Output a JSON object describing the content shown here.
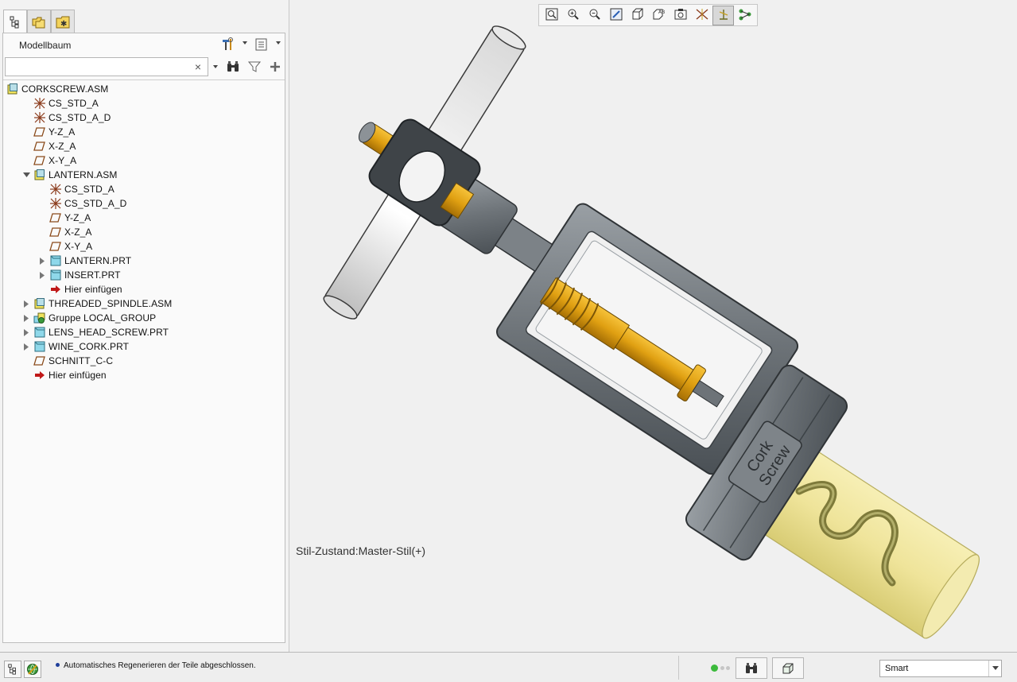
{
  "panel": {
    "tabs": [
      {
        "name": "model-tree-tab"
      },
      {
        "name": "folder-browser-tab"
      },
      {
        "name": "favorites-tab"
      }
    ],
    "title": "Modellbaum",
    "search": {
      "value": "",
      "placeholder": "",
      "clear_glyph": "×"
    }
  },
  "tree": [
    {
      "label": "CORKSCREW.ASM",
      "icon": "assembly-icon",
      "level": 0,
      "expander": "none"
    },
    {
      "label": "CS_STD_A",
      "icon": "csys-icon",
      "level": 1,
      "expander": "none"
    },
    {
      "label": "CS_STD_A_D",
      "icon": "csys-icon",
      "level": 1,
      "expander": "none"
    },
    {
      "label": "Y-Z_A",
      "icon": "datum-plane-icon",
      "level": 1,
      "expander": "none"
    },
    {
      "label": "X-Z_A",
      "icon": "datum-plane-icon",
      "level": 1,
      "expander": "none"
    },
    {
      "label": "X-Y_A",
      "icon": "datum-plane-icon",
      "level": 1,
      "expander": "none"
    },
    {
      "label": "LANTERN.ASM",
      "icon": "assembly-icon",
      "level": 1,
      "expander": "expanded"
    },
    {
      "label": "CS_STD_A",
      "icon": "csys-icon",
      "level": 2,
      "expander": "none"
    },
    {
      "label": "CS_STD_A_D",
      "icon": "csys-icon",
      "level": 2,
      "expander": "none"
    },
    {
      "label": "Y-Z_A",
      "icon": "datum-plane-icon",
      "level": 2,
      "expander": "none"
    },
    {
      "label": "X-Z_A",
      "icon": "datum-plane-icon",
      "level": 2,
      "expander": "none"
    },
    {
      "label": "X-Y_A",
      "icon": "datum-plane-icon",
      "level": 2,
      "expander": "none"
    },
    {
      "label": "LANTERN.PRT",
      "icon": "part-icon",
      "level": 2,
      "expander": "collapsed"
    },
    {
      "label": "INSERT.PRT",
      "icon": "part-icon",
      "level": 2,
      "expander": "collapsed"
    },
    {
      "label": "Hier einfügen",
      "icon": "insert-here-arrow-icon",
      "level": 2,
      "expander": "none"
    },
    {
      "label": "THREADED_SPINDLE.ASM",
      "icon": "assembly-icon",
      "level": 1,
      "expander": "collapsed"
    },
    {
      "label": "Gruppe LOCAL_GROUP",
      "icon": "group-icon",
      "level": 1,
      "expander": "collapsed"
    },
    {
      "label": "LENS_HEAD_SCREW.PRT",
      "icon": "part-icon",
      "level": 1,
      "expander": "collapsed"
    },
    {
      "label": "WINE_CORK.PRT",
      "icon": "part-icon",
      "level": 1,
      "expander": "collapsed"
    },
    {
      "label": "SCHNITT_C-C",
      "icon": "datum-plane-icon",
      "level": 1,
      "expander": "none"
    },
    {
      "label": "Hier einfügen",
      "icon": "insert-here-arrow-icon",
      "level": 1,
      "expander": "none"
    }
  ],
  "viewport": {
    "toolbar": [
      {
        "name": "refit-icon",
        "active": false
      },
      {
        "name": "zoom-in-icon",
        "active": false
      },
      {
        "name": "zoom-out-icon",
        "active": false
      },
      {
        "name": "repaint-icon",
        "active": false
      },
      {
        "name": "display-style-icon",
        "active": false
      },
      {
        "name": "saved-orientations-icon",
        "active": false
      },
      {
        "name": "view-manager-icon",
        "active": false
      },
      {
        "name": "datum-display-icon",
        "active": false
      },
      {
        "name": "csys-display-icon",
        "active": true
      },
      {
        "name": "annotation-display-icon",
        "active": false
      }
    ],
    "style_state": "Stil-Zustand:Master-Stil(+)",
    "model_label_line1": "Cork",
    "model_label_line2": "Screw"
  },
  "status": {
    "message": "Automatisches Regenerieren der Teile abgeschlossen.",
    "filter_value": "Smart"
  },
  "colors": {
    "steel": "#6d7378",
    "brass": "#e0a012",
    "cork": "#efe49a",
    "handle": "#f4f4f4"
  }
}
